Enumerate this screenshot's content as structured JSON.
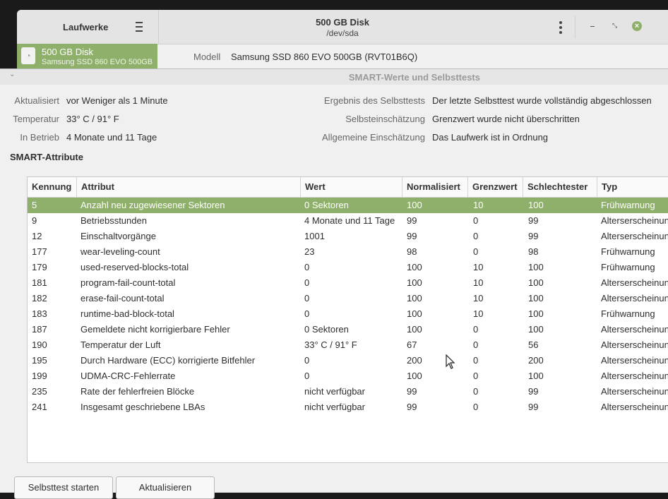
{
  "background_window": {
    "sidebar_title": "Laufwerke",
    "disk_title": "500 GB Disk",
    "disk_path": "/dev/sda",
    "selected_disk_name": "500 GB Disk",
    "selected_disk_model": "Samsung SSD 860 EVO 500GB",
    "modell_label": "Modell",
    "modell_value": "Samsung SSD 860 EVO 500GB (RVT01B6Q)",
    "accent_color": "#8fb06b"
  },
  "dialog": {
    "title": "SMART-Werte und Selbsttests",
    "info_left": [
      {
        "label": "Aktualisiert",
        "value": "vor Weniger als 1 Minute"
      },
      {
        "label": "Temperatur",
        "value": "33° C / 91° F"
      },
      {
        "label": "In Betrieb",
        "value": "4 Monate und 11 Tage"
      }
    ],
    "info_right": [
      {
        "label": "Ergebnis des Selbsttests",
        "value": "Der letzte Selbsttest wurde vollständig abgeschlossen"
      },
      {
        "label": "Selbsteinschätzung",
        "value": "Grenzwert wurde nicht überschritten"
      },
      {
        "label": "Allgemeine Einschätzung",
        "value": "Das Laufwerk ist in Ordnung"
      }
    ],
    "section_title": "SMART-Attribute",
    "columns": [
      "Kennung",
      "Attribut",
      "Wert",
      "Normalisiert",
      "Grenzwert",
      "Schlechtester",
      "Typ"
    ],
    "rows": [
      [
        "5",
        "Anzahl neu zugewiesener Sektoren",
        "0 Sektoren",
        "100",
        "10",
        "100",
        "Frühwarnung"
      ],
      [
        "9",
        "Betriebsstunden",
        "4 Monate und 11 Tage",
        "99",
        "0",
        "99",
        "Alterserscheinung"
      ],
      [
        "12",
        "Einschaltvorgänge",
        "1001",
        "99",
        "0",
        "99",
        "Alterserscheinung"
      ],
      [
        "177",
        "wear-leveling-count",
        "23",
        "98",
        "0",
        "98",
        "Frühwarnung"
      ],
      [
        "179",
        "used-reserved-blocks-total",
        "0",
        "100",
        "10",
        "100",
        "Frühwarnung"
      ],
      [
        "181",
        "program-fail-count-total",
        "0",
        "100",
        "10",
        "100",
        "Alterserscheinung"
      ],
      [
        "182",
        "erase-fail-count-total",
        "0",
        "100",
        "10",
        "100",
        "Alterserscheinung"
      ],
      [
        "183",
        "runtime-bad-block-total",
        "0",
        "100",
        "10",
        "100",
        "Frühwarnung"
      ],
      [
        "187",
        "Gemeldete nicht korrigierbare Fehler",
        "0 Sektoren",
        "100",
        "0",
        "100",
        "Alterserscheinung"
      ],
      [
        "190",
        "Temperatur der Luft",
        "33° C / 91° F",
        "67",
        "0",
        "56",
        "Alterserscheinung"
      ],
      [
        "195",
        "Durch Hardware (ECC) korrigierte Bitfehler",
        "0",
        "200",
        "0",
        "200",
        "Alterserscheinung"
      ],
      [
        "199",
        "UDMA-CRC-Fehlerrate",
        "0",
        "100",
        "0",
        "100",
        "Alterserscheinung"
      ],
      [
        "235",
        "Rate der fehlerfreien Blöcke",
        "nicht verfügbar",
        "99",
        "0",
        "99",
        "Alterserscheinung"
      ],
      [
        "241",
        "Insgesamt geschriebene LBAs",
        "nicht verfügbar",
        "99",
        "0",
        "99",
        "Alterserscheinung"
      ]
    ],
    "selected_row_index": 0,
    "buttons": {
      "start_selftest": "Selbsttest starten",
      "refresh": "Aktualisieren"
    }
  }
}
